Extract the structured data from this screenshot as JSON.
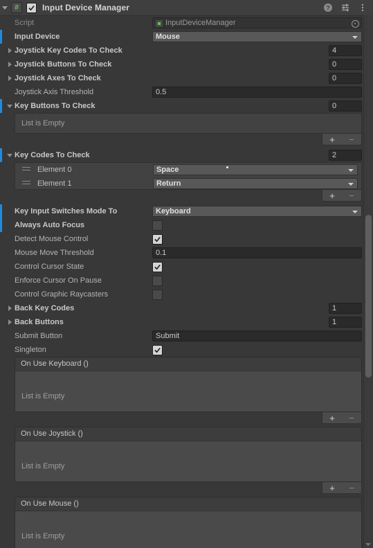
{
  "component": {
    "title": "Input Device Manager",
    "enabled": true,
    "script_icon": "#",
    "header_icons": [
      "help-icon",
      "preset-icon",
      "more-menu-icon"
    ]
  },
  "fields": {
    "script": {
      "label": "Script",
      "value": "InputDeviceManager"
    },
    "input_device": {
      "label": "Input Device",
      "value": "Mouse"
    },
    "joystick_key_codes": {
      "label": "Joystick Key Codes To Check",
      "size": "4"
    },
    "joystick_buttons": {
      "label": "Joystick Buttons To Check",
      "size": "0"
    },
    "joystick_axes": {
      "label": "Joystick Axes To Check",
      "size": "0"
    },
    "joystick_axis_threshold": {
      "label": "Joystick Axis Threshold",
      "value": "0.5"
    },
    "key_buttons": {
      "label": "Key Buttons To Check",
      "size": "0",
      "empty_text": "List is Empty"
    },
    "key_codes": {
      "label": "Key Codes To Check",
      "size": "2",
      "elements": [
        {
          "label": "Element 0",
          "value": "Space"
        },
        {
          "label": "Element 1",
          "value": "Return"
        }
      ]
    },
    "key_input_switches_mode": {
      "label": "Key Input Switches Mode To",
      "value": "Keyboard"
    },
    "always_auto_focus": {
      "label": "Always Auto Focus",
      "checked": false
    },
    "detect_mouse_control": {
      "label": "Detect Mouse Control",
      "checked": true
    },
    "mouse_move_threshold": {
      "label": "Mouse Move Threshold",
      "value": "0.1"
    },
    "control_cursor_state": {
      "label": "Control Cursor State",
      "checked": true
    },
    "enforce_cursor_on_pause": {
      "label": "Enforce Cursor On Pause",
      "checked": false
    },
    "control_graphic_raycasters": {
      "label": "Control Graphic Raycasters",
      "checked": false
    },
    "back_key_codes": {
      "label": "Back Key Codes",
      "size": "1"
    },
    "back_buttons": {
      "label": "Back Buttons",
      "size": "1"
    },
    "submit_button": {
      "label": "Submit Button",
      "value": "Submit"
    },
    "singleton": {
      "label": "Singleton",
      "checked": true
    }
  },
  "events": [
    {
      "title": "On Use Keyboard ()",
      "empty_text": "List is Empty"
    },
    {
      "title": "On Use Joystick ()",
      "empty_text": "List is Empty"
    },
    {
      "title": "On Use Mouse ()",
      "empty_text": "List is Empty"
    }
  ],
  "list_controls": {
    "add": "+",
    "remove": "−"
  },
  "colors": {
    "background": "#383838",
    "header": "#3f3f3f",
    "override_marker": "#1d8bdf",
    "field": "#2a2a2a",
    "popup": "#585858",
    "script_green": "#6bbf59"
  }
}
